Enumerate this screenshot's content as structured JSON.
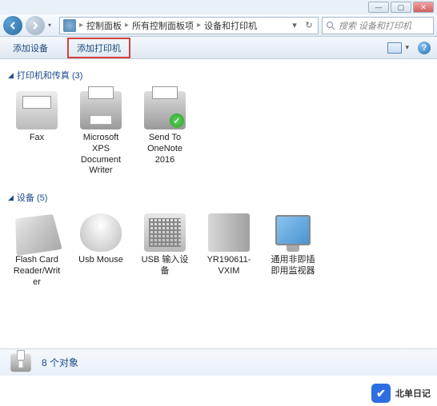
{
  "window": {
    "min": "—",
    "max": "▢",
    "close": "✕"
  },
  "breadcrumb": {
    "root": "控制面板",
    "mid": "所有控制面板项",
    "leaf": "设备和打印机"
  },
  "search": {
    "placeholder": "搜索 设备和打印机"
  },
  "toolbar": {
    "add_device": "添加设备",
    "add_printer": "添加打印机"
  },
  "sections": {
    "printers": {
      "title": "打印机和传真 (3)"
    },
    "devices": {
      "title": "设备 (5)"
    }
  },
  "printers": [
    {
      "label": "Fax",
      "icon": "fax"
    },
    {
      "label": "Microsoft XPS Document Writer",
      "icon": "printer"
    },
    {
      "label": "Send To OneNote 2016",
      "icon": "onenote"
    }
  ],
  "devices": [
    {
      "label": "Flash Card Reader/Writer",
      "icon": "card"
    },
    {
      "label": "Usb Mouse",
      "icon": "mouse"
    },
    {
      "label": "USB 输入设备",
      "icon": "kbd"
    },
    {
      "label": "YR190611-VXIM",
      "icon": "tower"
    },
    {
      "label": "通用非即插即用监视器",
      "icon": "monitor"
    }
  ],
  "status": {
    "count": "8 个对象"
  },
  "watermark": {
    "text": "北单日记"
  }
}
